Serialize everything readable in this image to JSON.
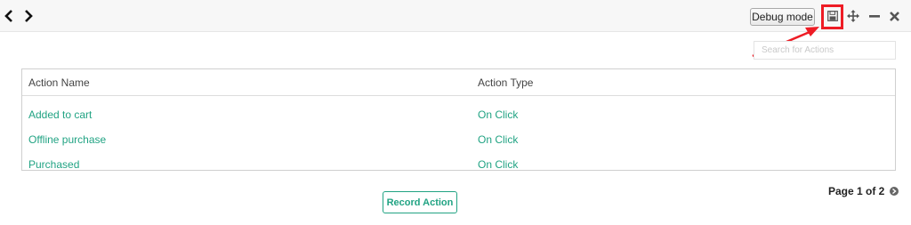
{
  "toolbar": {
    "back_icon": "chevron-left-icon",
    "forward_icon": "chevron-right-icon",
    "debug_label": "Debug mode",
    "save_icon": "save-icon",
    "move_icon": "move-icon",
    "minimize_icon": "minimize-icon",
    "close_icon": "close-icon"
  },
  "annotation": {
    "color": "#ee1c25"
  },
  "search": {
    "placeholder": "Search for Actions",
    "value": ""
  },
  "table": {
    "headers": [
      "Action Name",
      "Action Type"
    ],
    "rows": [
      {
        "name": "Added to cart",
        "type": "On Click"
      },
      {
        "name": "Offline purchase",
        "type": "On Click"
      },
      {
        "name": "Purchased",
        "type": "On Click"
      }
    ]
  },
  "record_button": {
    "label": "Record Action"
  },
  "pagination": {
    "label": "Page 1 of 2",
    "next_icon": "chevron-right-circle-icon"
  },
  "colors": {
    "accent": "#21a383",
    "highlight": "#ee1c25"
  }
}
